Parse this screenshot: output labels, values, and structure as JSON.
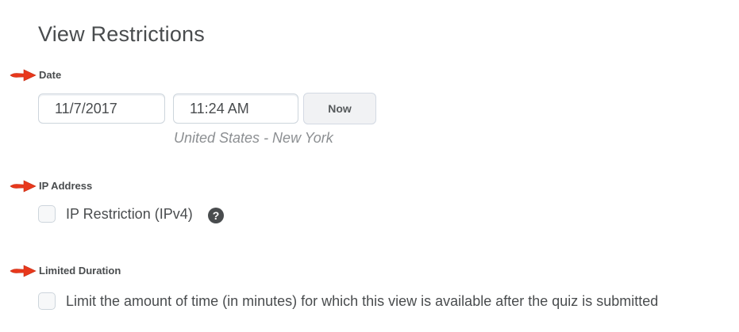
{
  "page": {
    "title": "View Restrictions"
  },
  "date_section": {
    "label": "Date",
    "date_value": "11/7/2017",
    "time_value": "11:24 AM",
    "now_label": "Now",
    "timezone": "United States - New York"
  },
  "ip_section": {
    "label": "IP Address",
    "checkbox_label": "IP Restriction (IPv4)",
    "checked": false,
    "help_glyph": "?"
  },
  "duration_section": {
    "label": "Limited Duration",
    "checkbox_label": "Limit the amount of time (in minutes) for which this view is available after the quiz is submitted",
    "checked": false
  },
  "annotations": {
    "arrow_icon": "red-arrow-right-icon",
    "arrow_color": "#e8381c"
  }
}
